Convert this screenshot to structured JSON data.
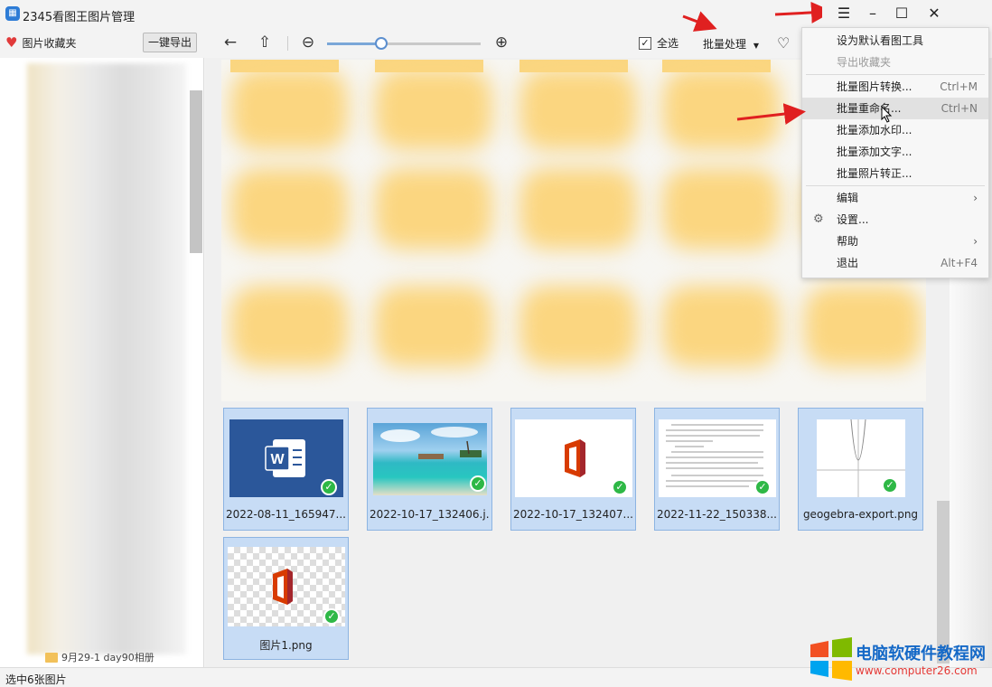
{
  "window": {
    "title": "2345看图王图片管理"
  },
  "toolbar": {
    "favorites": "图片收藏夹",
    "export": "一键导出",
    "select_all": "全选",
    "batch": "批量处理",
    "zoom_level": 0.35
  },
  "sidebar": {
    "last_item": "9月29-1  day90相册"
  },
  "thumbnails": [
    {
      "caption": "2022-08-11_165947...."
    },
    {
      "caption": "2022-10-17_132406.j..."
    },
    {
      "caption": "2022-10-17_132407...."
    },
    {
      "caption": "2022-11-22_150338...."
    },
    {
      "caption": "geogebra-export.png"
    },
    {
      "caption": "图片1.png"
    }
  ],
  "menu": {
    "items": [
      {
        "label": "设为默认看图工具",
        "shortcut": ""
      },
      {
        "label": "导出收藏夹",
        "shortcut": ""
      },
      {
        "label": "批量图片转换...",
        "shortcut": "Ctrl+M"
      },
      {
        "label": "批量重命名...",
        "shortcut": "Ctrl+N"
      },
      {
        "label": "批量添加水印...",
        "shortcut": ""
      },
      {
        "label": "批量添加文字...",
        "shortcut": ""
      },
      {
        "label": "批量照片转正...",
        "shortcut": ""
      },
      {
        "label": "编辑",
        "shortcut": ""
      },
      {
        "label": "设置...",
        "shortcut": ""
      },
      {
        "label": "帮助",
        "shortcut": ""
      },
      {
        "label": "退出",
        "shortcut": "Alt+F4"
      }
    ]
  },
  "status": {
    "text": "选中6张图片"
  },
  "watermark": {
    "name": "电脑软硬件教程网",
    "url": "www.computer26.com"
  },
  "colors": {
    "accent": "#2e7cd6",
    "selection": "#c7dcf5",
    "check": "#2eb846",
    "word": "#2b579a"
  }
}
